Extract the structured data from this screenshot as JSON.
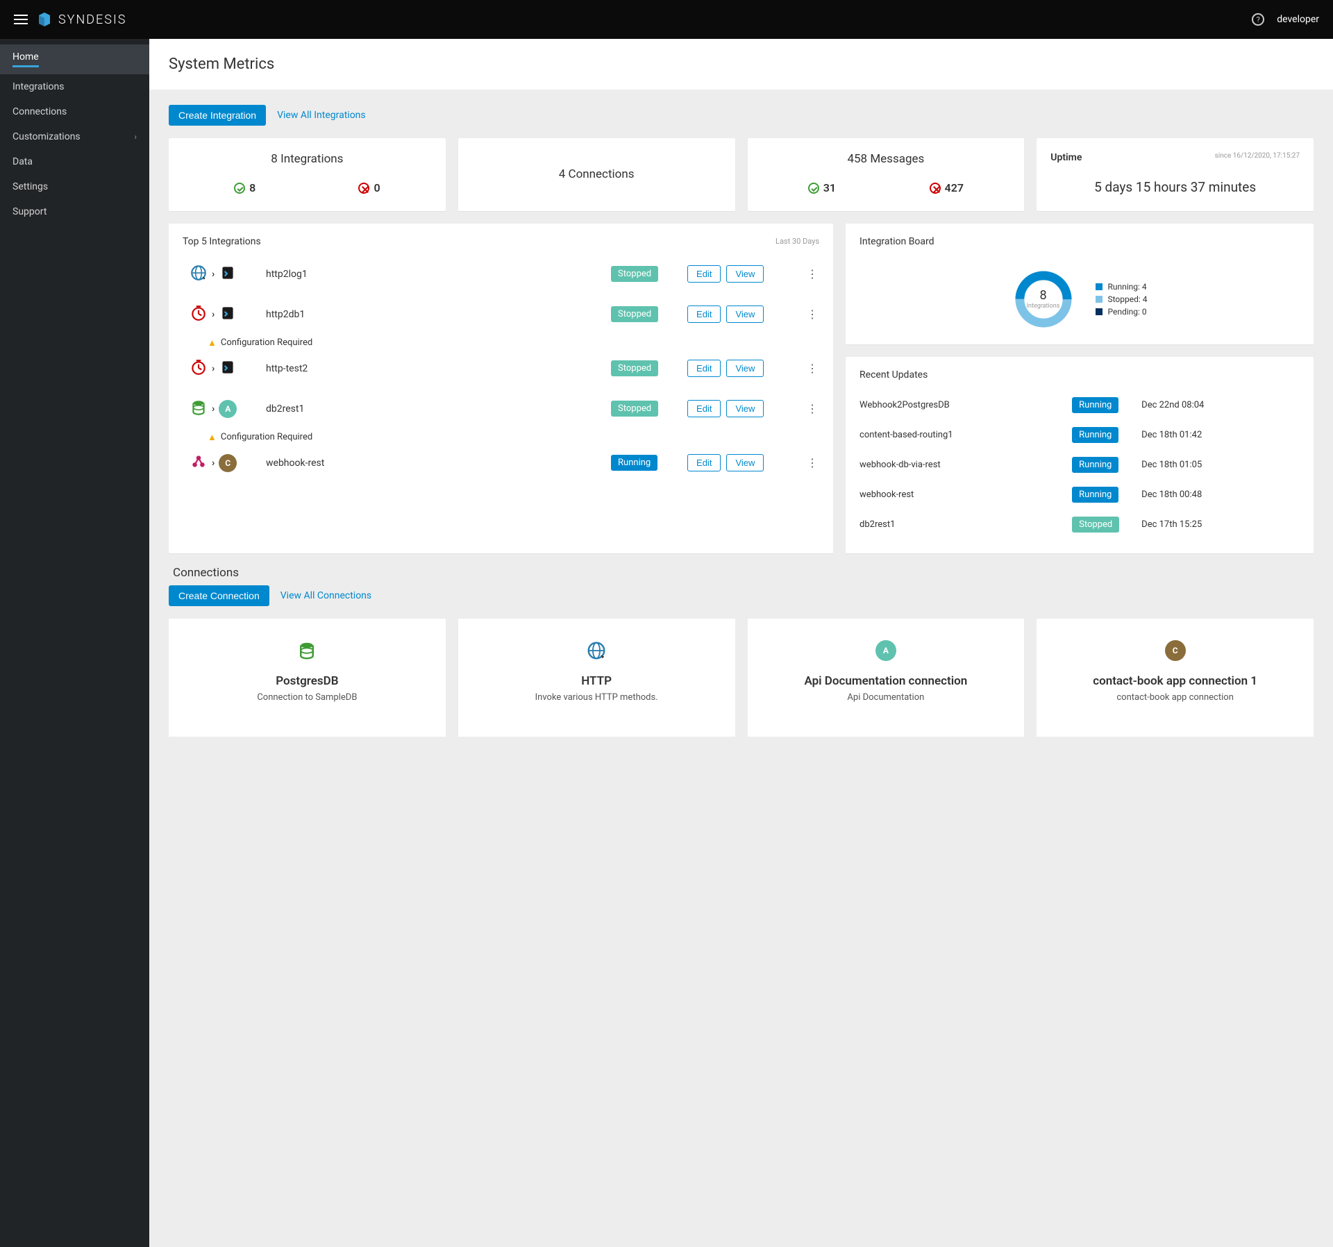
{
  "brand": "SYNDESIS",
  "user": "developer",
  "sidebar": {
    "items": [
      {
        "label": "Home",
        "active": true
      },
      {
        "label": "Integrations"
      },
      {
        "label": "Connections"
      },
      {
        "label": "Customizations",
        "expandable": true
      },
      {
        "label": "Data"
      },
      {
        "label": "Settings"
      },
      {
        "label": "Support"
      }
    ]
  },
  "page_title": "System Metrics",
  "actions": {
    "create_integration": "Create Integration",
    "view_all_integrations": "View All Integrations",
    "create_connection": "Create Connection",
    "view_all_connections": "View All Connections"
  },
  "metrics": {
    "integrations": {
      "title": "8 Integrations",
      "ok": "8",
      "err": "0"
    },
    "connections": {
      "title": "4 Connections"
    },
    "messages": {
      "title": "458 Messages",
      "ok": "31",
      "err": "427"
    },
    "uptime": {
      "title": "Uptime",
      "since": "since 16/12/2020, 17:15:27",
      "value": "5 days 15 hours 37 minutes"
    }
  },
  "top_integrations": {
    "title": "Top 5 Integrations",
    "period": "Last 30 Days",
    "edit_label": "Edit",
    "view_label": "View",
    "config_required": "Configuration Required",
    "items": [
      {
        "name": "http2log1",
        "status": "Stopped",
        "status_type": "stopped",
        "icons": [
          "globe",
          "script"
        ],
        "config_req": false
      },
      {
        "name": "http2db1",
        "status": "Stopped",
        "status_type": "stopped",
        "icons": [
          "timer",
          "script"
        ],
        "config_req": true
      },
      {
        "name": "http-test2",
        "status": "Stopped",
        "status_type": "stopped",
        "icons": [
          "timer",
          "script"
        ],
        "config_req": false
      },
      {
        "name": "db2rest1",
        "status": "Stopped",
        "status_type": "stopped",
        "icons": [
          "db",
          "a"
        ],
        "config_req": true
      },
      {
        "name": "webhook-rest",
        "status": "Running",
        "status_type": "running",
        "icons": [
          "hook",
          "c"
        ],
        "config_req": false
      }
    ]
  },
  "integration_board": {
    "title": "Integration Board",
    "total": "8",
    "total_label": "Integrations",
    "legend": [
      {
        "label": "Running: 4",
        "color": "#0088ce"
      },
      {
        "label": "Stopped: 4",
        "color": "#7dc3e8"
      },
      {
        "label": "Pending: 0",
        "color": "#002f5d"
      }
    ]
  },
  "chart_data": {
    "type": "pie",
    "title": "Integration Board",
    "series": [
      {
        "name": "Running",
        "value": 4,
        "color": "#0088ce"
      },
      {
        "name": "Stopped",
        "value": 4,
        "color": "#7dc3e8"
      },
      {
        "name": "Pending",
        "value": 0,
        "color": "#002f5d"
      }
    ],
    "total": 8,
    "total_label": "Integrations"
  },
  "recent_updates": {
    "title": "Recent Updates",
    "items": [
      {
        "name": "Webhook2PostgresDB",
        "status": "Running",
        "status_type": "running",
        "date": "Dec 22nd 08:04"
      },
      {
        "name": "content-based-routing1",
        "status": "Running",
        "status_type": "running",
        "date": "Dec 18th 01:42"
      },
      {
        "name": "webhook-db-via-rest",
        "status": "Running",
        "status_type": "running",
        "date": "Dec 18th 01:05"
      },
      {
        "name": "webhook-rest",
        "status": "Running",
        "status_type": "running",
        "date": "Dec 18th 00:48"
      },
      {
        "name": "db2rest1",
        "status": "Stopped",
        "status_type": "stopped",
        "date": "Dec 17th 15:25"
      }
    ]
  },
  "connections_section": {
    "title": "Connections",
    "items": [
      {
        "name": "PostgresDB",
        "desc": "Connection to SampleDB",
        "icon": "db"
      },
      {
        "name": "HTTP",
        "desc": "Invoke various HTTP methods.",
        "icon": "globe"
      },
      {
        "name": "Api Documentation connection",
        "desc": "Api Documentation",
        "icon": "a"
      },
      {
        "name": "contact-book app connection 1",
        "desc": "contact-book app connection",
        "icon": "c"
      }
    ]
  }
}
